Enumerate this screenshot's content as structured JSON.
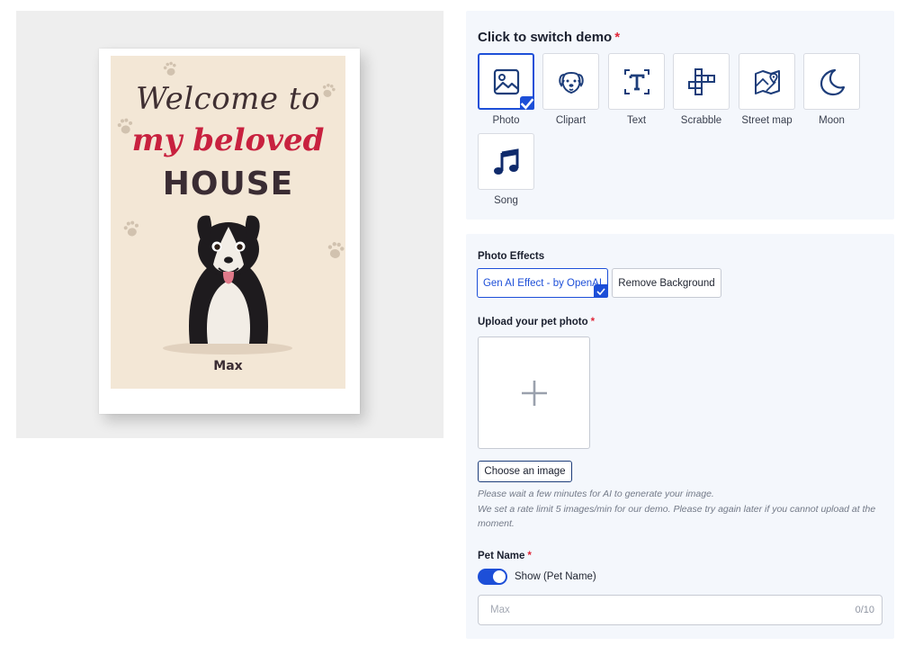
{
  "preview": {
    "headline_1": "Welcome to",
    "headline_2": "my beloved",
    "headline_3": "HOUSE",
    "pet_name": "Max",
    "poster_background": "#f3e7d6",
    "accent_red": "#c8213f"
  },
  "demo_switcher": {
    "title": "Click to switch demo",
    "required_mark": "*",
    "selected": "Photo",
    "items": [
      {
        "label": "Photo",
        "icon": "image-icon"
      },
      {
        "label": "Clipart",
        "icon": "dog-face-icon"
      },
      {
        "label": "Text",
        "icon": "text-icon"
      },
      {
        "label": "Scrabble",
        "icon": "crossword-icon"
      },
      {
        "label": "Street map",
        "icon": "map-icon"
      },
      {
        "label": "Moon",
        "icon": "moon-icon"
      },
      {
        "label": "Song",
        "icon": "music-note-icon"
      }
    ]
  },
  "photo_effects": {
    "label": "Photo Effects",
    "options": [
      {
        "label": "Gen AI Effect - by OpenAI",
        "selected": true
      },
      {
        "label": "Remove Background",
        "selected": false
      }
    ]
  },
  "upload": {
    "label": "Upload your pet photo",
    "required_mark": "*",
    "button_label": "Choose an image",
    "notice_1": "Please wait a few minutes for AI to generate your image.",
    "notice_2": "We set a rate limit 5 images/min for our demo. Please try again later if you cannot upload at the moment."
  },
  "pet_name_field": {
    "label": "Pet Name",
    "required_mark": "*",
    "toggle_label": "Show (Pet Name)",
    "toggle_on": true,
    "placeholder": "Max",
    "value": "",
    "counter": "0/10"
  },
  "colors": {
    "accent_blue": "#1d4fd8",
    "panel_bg": "#f4f7fc",
    "required_red": "#e0283a"
  }
}
